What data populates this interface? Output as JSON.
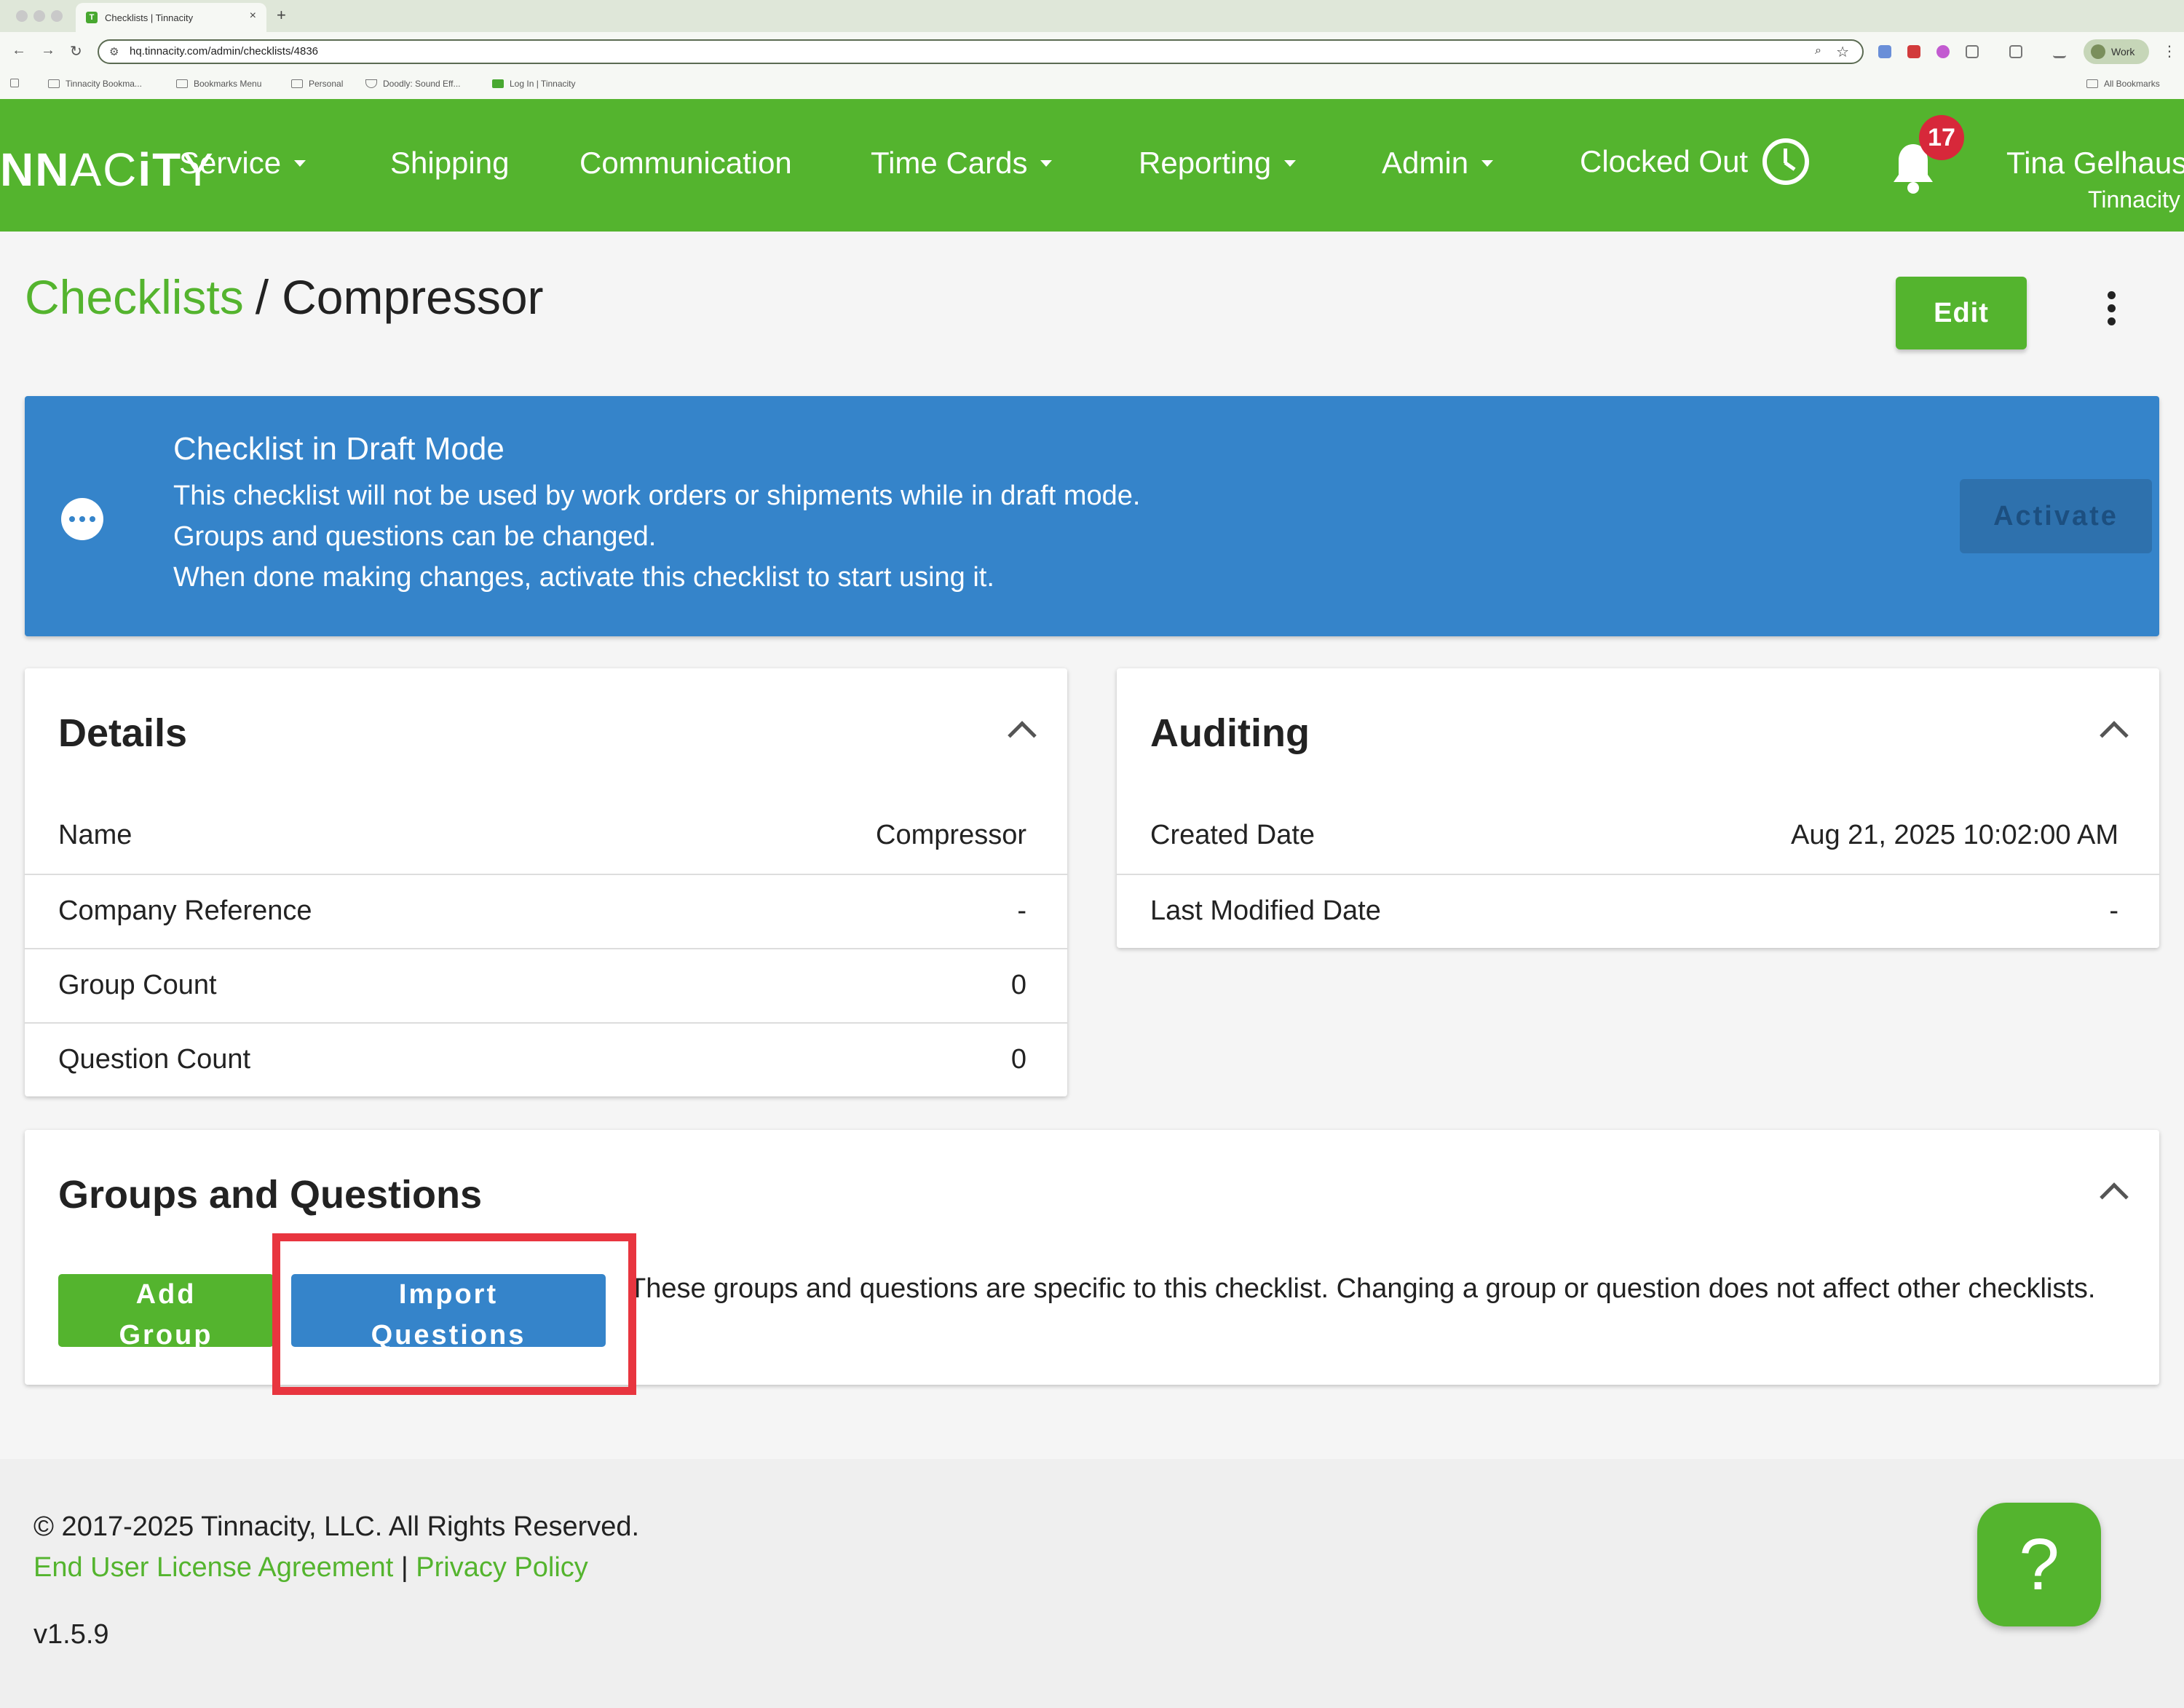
{
  "browser": {
    "tab_title": "Checklists | Tinnacity",
    "tab_favicon": "T",
    "tab_close": "×",
    "new_tab": "+",
    "url": "hq.tinnacity.com/admin/checklists/4836",
    "profile_label": "Work",
    "bookmarks": [
      "Tinnacity Bookma...",
      "Bookmarks Menu",
      "Personal",
      "Doodly: Sound Eff...",
      "Log In | Tinnacity"
    ],
    "all_bookmarks": "All Bookmarks"
  },
  "header": {
    "logo_left": "NN",
    "logo_mid": "AC",
    "logo_bold": "iT",
    "logo_right": "Y",
    "nav": {
      "service": "Service",
      "shipping": "Shipping",
      "communication": "Communication",
      "time_cards": "Time Cards",
      "reporting": "Reporting",
      "admin": "Admin",
      "clocked_out": "Clocked Out"
    },
    "notification_count": "17",
    "user_name": "Tina Gelhaus",
    "user_company": "Tinnacity"
  },
  "page": {
    "breadcrumb_parent": "Checklists",
    "breadcrumb_sep": "/",
    "breadcrumb_current": "Compressor",
    "edit_label": "Edit"
  },
  "banner": {
    "title": "Checklist in Draft Mode",
    "line1": "This checklist will not be used by work orders or shipments while in draft mode.",
    "line2": "Groups and questions can be changed.",
    "line3": "When done making changes, activate this checklist to start using it.",
    "activate_label": "Activate"
  },
  "details": {
    "title": "Details",
    "rows": [
      {
        "label": "Name",
        "value": "Compressor"
      },
      {
        "label": "Company Reference",
        "value": "-"
      },
      {
        "label": "Group Count",
        "value": "0"
      },
      {
        "label": "Question Count",
        "value": "0"
      }
    ]
  },
  "auditing": {
    "title": "Auditing",
    "rows": [
      {
        "label": "Created Date",
        "value": "Aug 21, 2025 10:02:00 AM"
      },
      {
        "label": "Last Modified Date",
        "value": "-"
      }
    ]
  },
  "groups": {
    "title": "Groups and Questions",
    "add_group_line1": "Add",
    "add_group_line2": "Group",
    "import_line1": "Import",
    "import_line2": "Questions",
    "description": "These groups and questions are specific to this checklist. Changing a group or question does not affect other checklists."
  },
  "footer": {
    "copyright": "© 2017-2025 Tinnacity, LLC. All Rights Reserved.",
    "eula": "End User License Agreement",
    "separator": "|",
    "privacy": "Privacy Policy",
    "version": "v1.5.9",
    "help": "?"
  },
  "colors": {
    "brand_green": "#54b42e",
    "banner_blue": "#3584ca",
    "highlight_red": "#e8353f",
    "badge_red": "#d7283a"
  }
}
